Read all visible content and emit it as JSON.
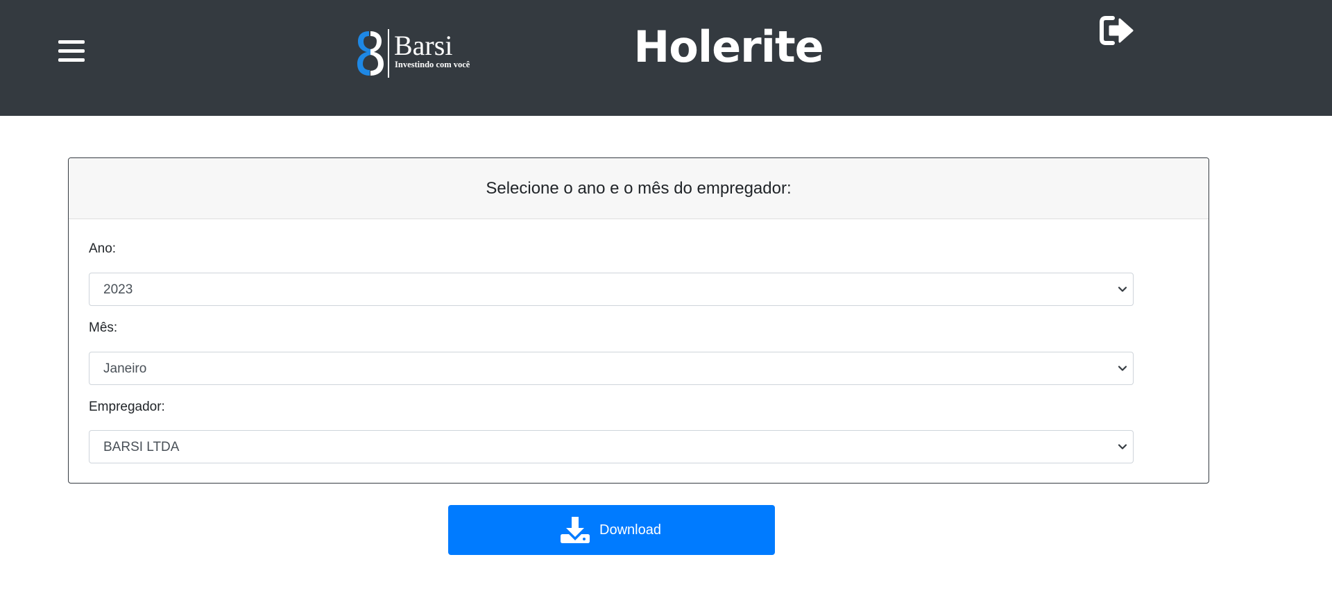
{
  "header": {
    "title": "Holerite",
    "logo": {
      "name": "Barsi",
      "tagline": "Investindo com você"
    }
  },
  "form": {
    "heading": "Selecione o ano e o mês do empregador:",
    "year": {
      "label": "Ano:",
      "value": "2023"
    },
    "month": {
      "label": "Mês:",
      "value": "Janeiro"
    },
    "employer": {
      "label": "Empregador:",
      "value": "BARSI LTDA"
    }
  },
  "download_button": {
    "label": "Download"
  },
  "colors": {
    "header_bg": "#343a40",
    "primary": "#007bff",
    "logo_blue": "#1e88e5"
  },
  "icons": [
    "hamburger-menu-icon",
    "barsi-logo-icon",
    "sign-out-icon",
    "chevron-down-icon",
    "download-icon"
  ]
}
